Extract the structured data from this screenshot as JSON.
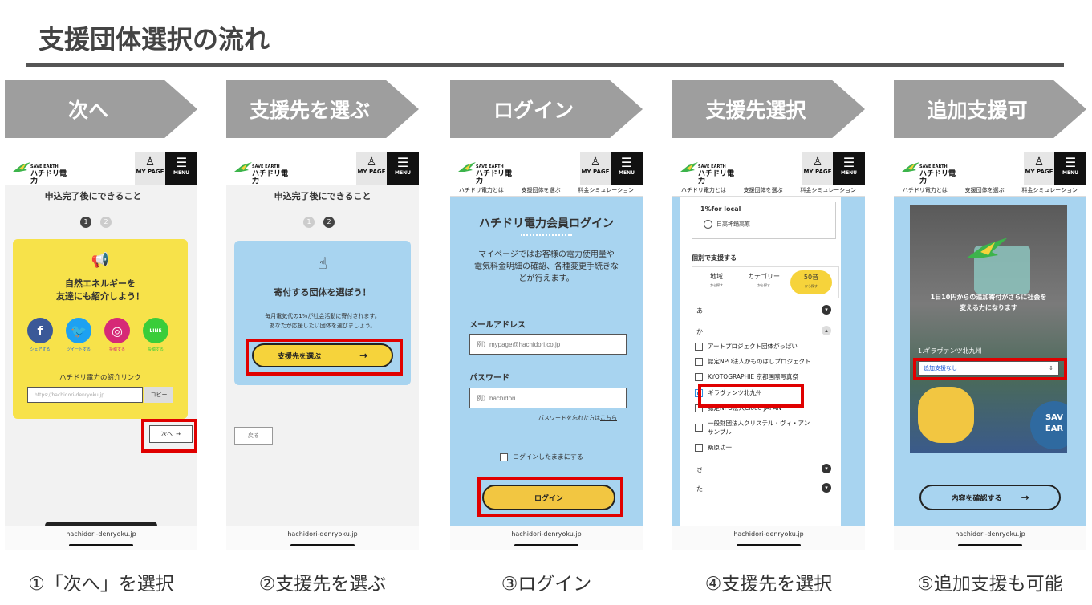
{
  "title": "支援団体選択の流れ",
  "steps": [
    {
      "arrow": "次へ",
      "caption": "①「次へ」を選択"
    },
    {
      "arrow": "支援先を選ぶ",
      "caption": "②支援先を選ぶ"
    },
    {
      "arrow": "ログイン",
      "caption": "③ログイン"
    },
    {
      "arrow": "支援先選択",
      "caption": "④支援先を選択"
    },
    {
      "arrow": "追加支援可",
      "caption": "⑤追加支援も可能"
    }
  ],
  "header": {
    "logo_top": "SAVE EARTH",
    "logo_name": "ハチドリ電力",
    "mypage": "MY PAGE",
    "menu": "MENU",
    "nav": [
      "ハチドリ電力とは",
      "支援団体を選ぶ",
      "料金シミュレーション"
    ],
    "footer_url": "hachidori-denryoku.jp"
  },
  "s1": {
    "heading": "申込完了後にできること",
    "page1": "1",
    "page2": "2",
    "card_title": "自然エネルギーを\n友達にも紹介しよう！",
    "share": [
      "シェアする",
      "ツイートする",
      "投稿する",
      "投稿する"
    ],
    "link_label": "ハチドリ電力の紹介リンク",
    "link_value": "https://hachidori-denryoku.jp",
    "copy": "コピー",
    "next": "次へ"
  },
  "s2": {
    "heading": "申込完了後にできること",
    "page1": "1",
    "page2": "2",
    "card_title": "寄付する団体を選ぼう！",
    "card_desc": "毎月電気代の1%が社会活動に寄付されます。\nあなたが応援したい団体を選びましょう。",
    "select_btn": "支援先を選ぶ",
    "back": "戻る"
  },
  "s3": {
    "heading": "ハチドリ電力会員ログイン",
    "desc": "マイページではお客様の電力使用量や\n電気料金明細の確認、各種変更手続きな\nどが行えます。",
    "email_label": "メールアドレス",
    "email_placeholder": "例）mypage@hachidori.co.jp",
    "password_label": "パスワード",
    "password_placeholder": "例）hachidori",
    "forgot": "パスワードを忘れた方は",
    "forgot_link": "こちら",
    "keep": "ログインしたままにする",
    "login": "ログイン"
  },
  "s4": {
    "section1": "1%for local",
    "radio1": "日高神鍋高原",
    "section2": "個別で支援する",
    "tabs": [
      {
        "label": "地域",
        "sub": "から探す"
      },
      {
        "label": "カテゴリー",
        "sub": "から探す"
      },
      {
        "label": "50音",
        "sub": "から探す"
      }
    ],
    "kana_a": "あ",
    "kana_ka": "か",
    "orgs": [
      "アートプロジェクト団体がっぱい",
      "認定NPO法人かものはしプロジェクト",
      "KYOTOGRAPHIE 京都国際写真祭",
      "ギラヴァンツ北九州",
      "認定NPO法人Cloud JAPAN",
      "一般財団法人クリステル・ヴィ・アン\nサンブル",
      "桑原功一"
    ],
    "kana_sa": "さ",
    "kana_ta": "た"
  },
  "s5": {
    "overlay": "1日10円からの追加寄付がさらに社会を\n変える力になります",
    "team": "1.ギラヴァンツ北九州",
    "select_value": "追加支援なし",
    "confirm": "内容を確認する"
  },
  "colors": {
    "arrow": "#9e9e9e",
    "highlight": "#e00000",
    "yellow": "#f6d33b",
    "blue": "#a8d4f0"
  }
}
